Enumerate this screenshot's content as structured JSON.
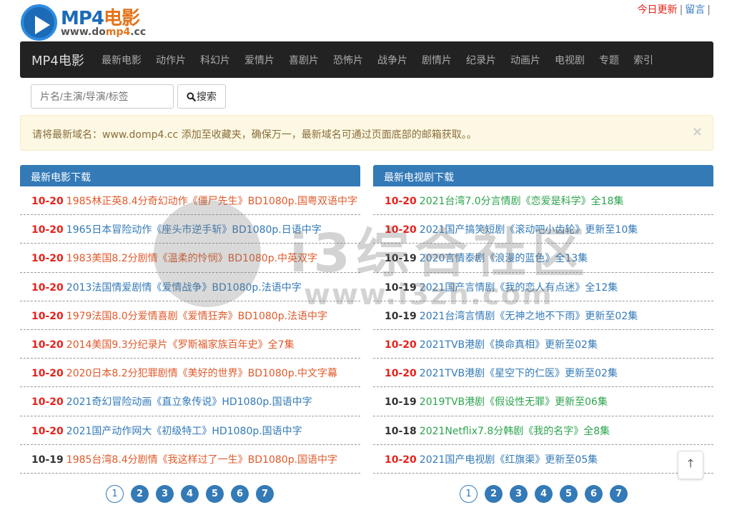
{
  "logo": {
    "title_mp4": "MP4",
    "title_cn": "电影",
    "url_pre": "www.do",
    "url_accent": "mp4",
    "url_post": ".cc"
  },
  "toplinks": {
    "today": "今日更新",
    "sep": "|",
    "message": "留言"
  },
  "navbar": {
    "brand": "MP4电影",
    "items": [
      "最新电影",
      "动作片",
      "科幻片",
      "爱情片",
      "喜剧片",
      "恐怖片",
      "战争片",
      "剧情片",
      "纪录片",
      "动画片",
      "电视剧",
      "专题",
      "索引"
    ]
  },
  "search": {
    "placeholder": "片名/主演/导演/标签",
    "button": "搜索"
  },
  "alert": {
    "text": "请将最新域名：www.domp4.cc 添加至收藏夹，确保万一，最新域名可通过页面底部的邮箱获取。。",
    "close": "×"
  },
  "movies": {
    "title": "最新电影下载",
    "rows": [
      {
        "date": "10-20",
        "title": "1985林正英8.4分奇幻动作《僵尸先生》BD1080p.国粤双语中字",
        "date_color": "red",
        "link_color": "orange"
      },
      {
        "date": "10-20",
        "title": "1965日本冒险动作《座头市逆手斩》BD1080p.日语中字",
        "date_color": "red",
        "link_color": "blue"
      },
      {
        "date": "10-20",
        "title": "1983美国8.2分剧情《温柔的怜悯》BD1080p.中英双字",
        "date_color": "red",
        "link_color": "orange"
      },
      {
        "date": "10-20",
        "title": "2013法国情爱剧情《爱情战争》BD1080p.法语中字",
        "date_color": "red",
        "link_color": "blue"
      },
      {
        "date": "10-20",
        "title": "1979法国8.0分爱情喜剧《爱情狂奔》BD1080p.法语中字",
        "date_color": "red",
        "link_color": "orange"
      },
      {
        "date": "10-20",
        "title": "2014美国9.3分纪录片《罗斯福家族百年史》全7集",
        "date_color": "red",
        "link_color": "orange"
      },
      {
        "date": "10-20",
        "title": "2020日本8.2分犯罪剧情《美好的世界》BD1080p.中文字幕",
        "date_color": "red",
        "link_color": "orange"
      },
      {
        "date": "10-20",
        "title": "2021奇幻冒险动画《直立象传说》HD1080p.国语中字",
        "date_color": "red",
        "link_color": "blue"
      },
      {
        "date": "10-20",
        "title": "2021国产动作网大《初级特工》HD1080p.国语中字",
        "date_color": "red",
        "link_color": "blue"
      },
      {
        "date": "10-19",
        "title": "1985台湾8.4分剧情《我这样过了一生》BD1080p.国语中字",
        "date_color": "black",
        "link_color": "orange"
      }
    ],
    "pages": [
      "1",
      "2",
      "3",
      "4",
      "5",
      "6",
      "7"
    ]
  },
  "tv": {
    "title": "最新电视剧下载",
    "rows": [
      {
        "date": "10-20",
        "title": "2021台湾7.0分言情剧《恋爱是科学》全18集",
        "date_color": "red",
        "link_color": "green"
      },
      {
        "date": "10-20",
        "title": "2021国产搞笑短剧《滚动吧小齿轮》更新至10集",
        "date_color": "red",
        "link_color": "blue"
      },
      {
        "date": "10-19",
        "title": "2020言情泰剧《浪漫的蓝色》全13集",
        "date_color": "black",
        "link_color": "blue"
      },
      {
        "date": "10-19",
        "title": "2021国产言情剧《我的恋人有点迷》全12集",
        "date_color": "black",
        "link_color": "blue"
      },
      {
        "date": "10-19",
        "title": "2021台湾言情剧《无神之地不下雨》更新至02集",
        "date_color": "black",
        "link_color": "blue"
      },
      {
        "date": "10-20",
        "title": "2021TVB港剧《换命真相》更新至02集",
        "date_color": "red",
        "link_color": "blue"
      },
      {
        "date": "10-20",
        "title": "2021TVB港剧《星空下的仁医》更新至02集",
        "date_color": "red",
        "link_color": "blue"
      },
      {
        "date": "10-19",
        "title": "2019TVB港剧《假设性无罪》更新至06集",
        "date_color": "black",
        "link_color": "green"
      },
      {
        "date": "10-18",
        "title": "2021Netflix7.8分韩剧《我的名字》全8集",
        "date_color": "black",
        "link_color": "green"
      },
      {
        "date": "10-20",
        "title": "2021国产电视剧《红旗渠》更新至05集",
        "date_color": "red",
        "link_color": "blue"
      }
    ],
    "pages": [
      "1",
      "2",
      "3",
      "4",
      "5",
      "6",
      "7"
    ]
  },
  "back_top": {
    "glyph": "🡑"
  },
  "watermark": {
    "cn": "i3综合社区",
    "url": "www.i3zh.com"
  }
}
